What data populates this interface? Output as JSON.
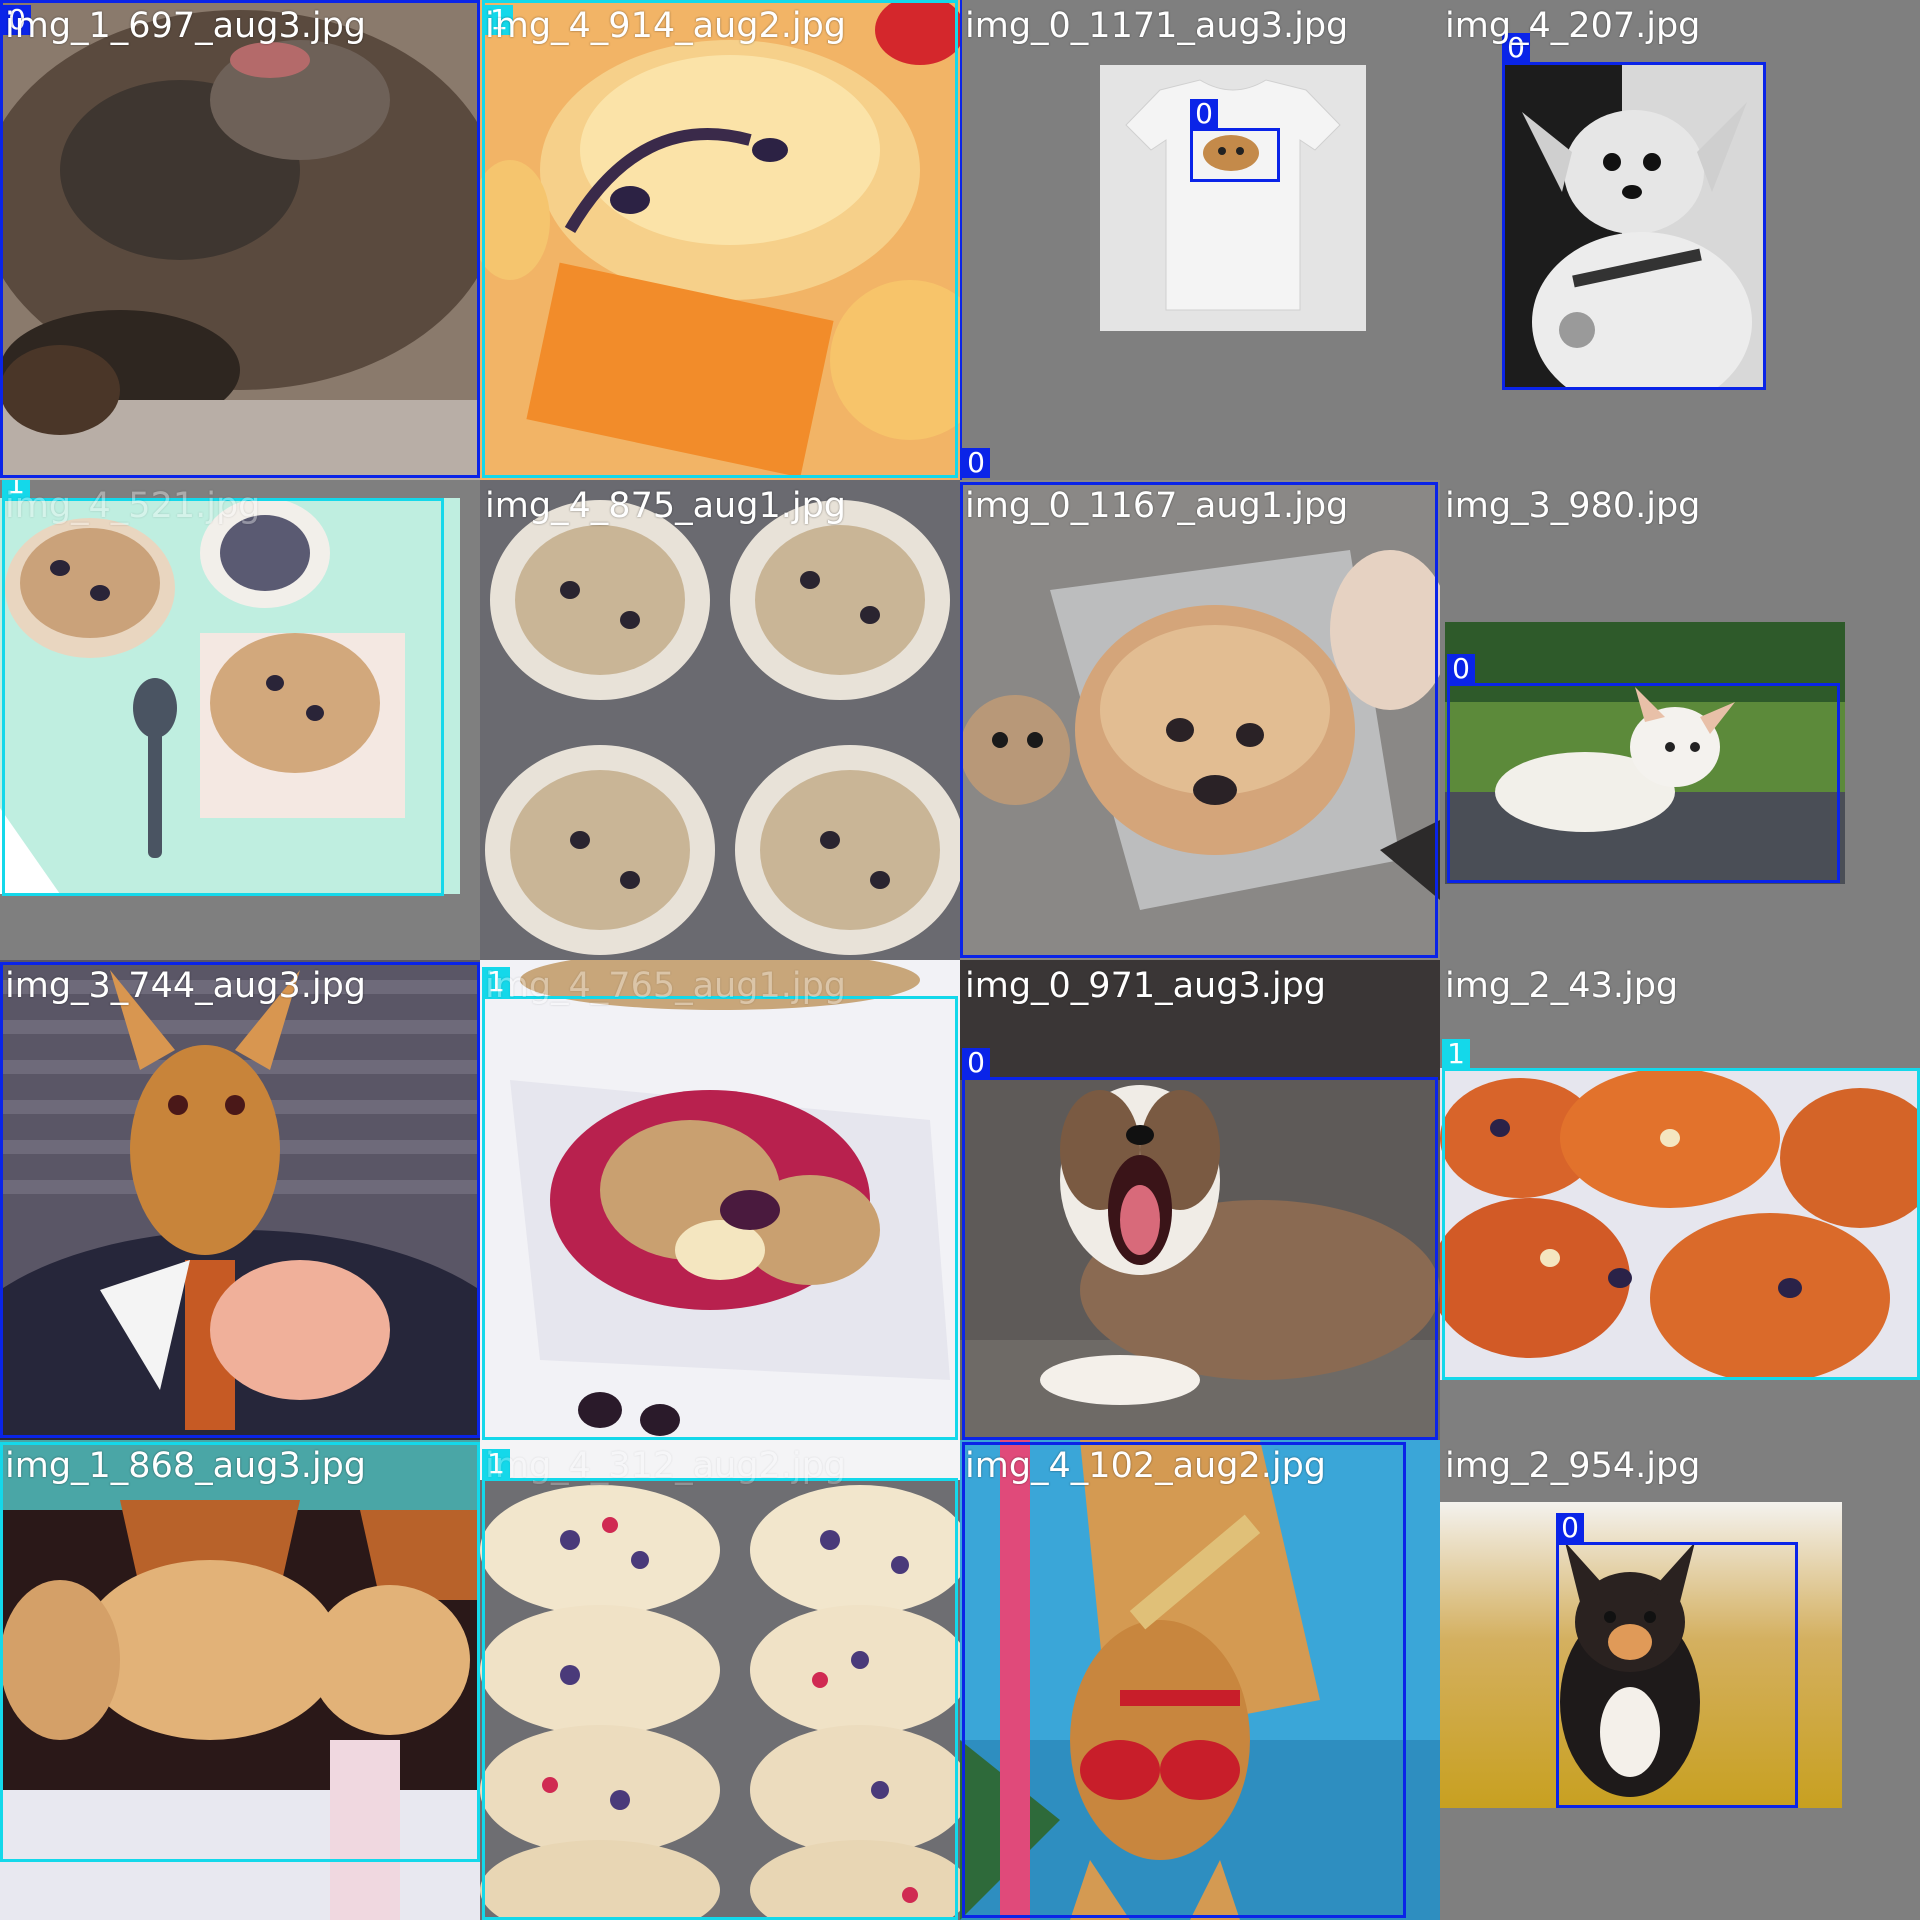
{
  "colors": {
    "class_0_box": "#0a24e8",
    "class_1_box": "#14d8ea",
    "background": "#7f7f7f",
    "label_text": "#ffffff"
  },
  "tiles": [
    {
      "filename": "img_1_697_aug3.jpg",
      "subject": "dog close-up, fur",
      "boxes": [
        {
          "cls": "0"
        }
      ]
    },
    {
      "filename": "img_4_914_aug2.jpg",
      "subject": "blueberry muffins",
      "boxes": [
        {
          "cls": "1"
        }
      ]
    },
    {
      "filename": "img_0_1171_aug3.jpg",
      "subject": "t-shirt with chihuahua print",
      "boxes": [
        {
          "cls": "0"
        },
        {
          "cls": "0"
        }
      ]
    },
    {
      "filename": "img_4_207.jpg",
      "subject": "chihuahua black and white photo",
      "boxes": [
        {
          "cls": "0"
        }
      ]
    },
    {
      "filename": "img_4_521.jpg",
      "subject": "muffins on mint table",
      "boxes": [
        {
          "cls": "1"
        }
      ]
    },
    {
      "filename": "img_4_875_aug1.jpg",
      "subject": "muffins in paper cups",
      "boxes": []
    },
    {
      "filename": "img_0_1167_aug1.jpg",
      "subject": "muffin in bag and chihuahua",
      "boxes": [
        {
          "cls": "0"
        }
      ]
    },
    {
      "filename": "img_3_980.jpg",
      "subject": "white chihuahua on rug",
      "boxes": [
        {
          "cls": "0"
        }
      ]
    },
    {
      "filename": "img_3_744_aug3.jpg",
      "subject": "chihuahua with drink",
      "boxes": [
        {
          "cls": "0"
        }
      ]
    },
    {
      "filename": "img_4_765_aug1.jpg",
      "subject": "berry crumble muffin",
      "boxes": [
        {
          "cls": "1"
        }
      ]
    },
    {
      "filename": "img_0_971_aug3.jpg",
      "subject": "yawning puppy",
      "boxes": [
        {
          "cls": "0"
        }
      ]
    },
    {
      "filename": "img_2_43.jpg",
      "subject": "blueberry muffins close-up",
      "boxes": [
        {
          "cls": "1"
        }
      ]
    },
    {
      "filename": "img_1_868_aug3.jpg",
      "subject": "upside-down muffins",
      "boxes": [
        {
          "cls": "1"
        }
      ]
    },
    {
      "filename": "img_4_312_aug2.jpg",
      "subject": "muffins in tin",
      "boxes": [
        {
          "cls": "1"
        }
      ]
    },
    {
      "filename": "img_4_102_aug2.jpg",
      "subject": "dog with sunglasses upside-down",
      "boxes": [
        {
          "cls": "0"
        }
      ]
    },
    {
      "filename": "img_2_954.jpg",
      "subject": "long-haired chihuahua running",
      "boxes": [
        {
          "cls": "0"
        }
      ]
    }
  ]
}
